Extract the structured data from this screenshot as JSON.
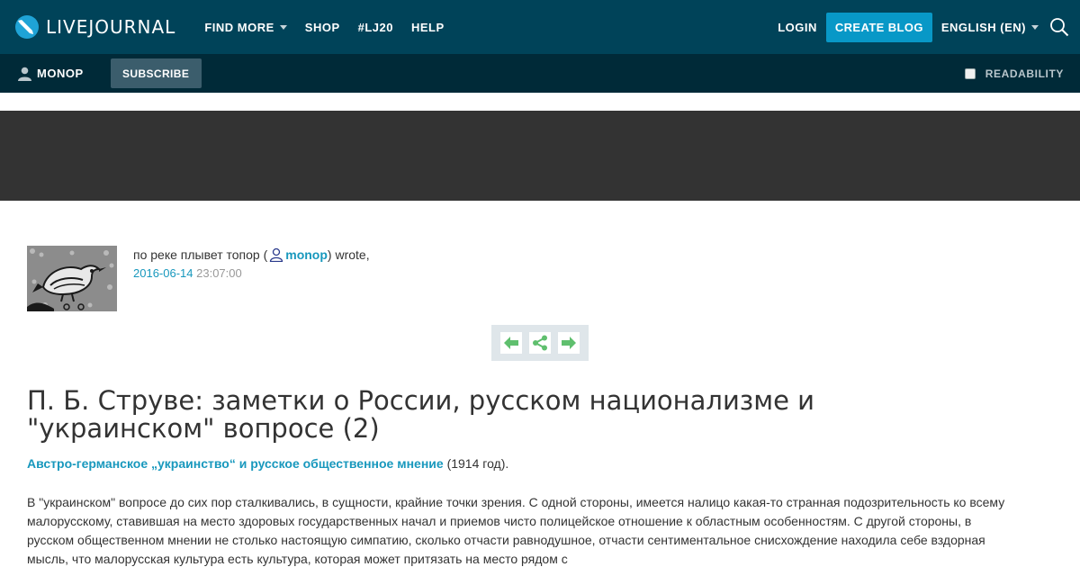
{
  "header": {
    "logo_text": "LIVEJOURNAL",
    "nav": [
      {
        "label": "FIND MORE",
        "dropdown": true
      },
      {
        "label": "SHOP",
        "dropdown": false
      },
      {
        "label": "#LJ20",
        "dropdown": false
      },
      {
        "label": "HELP",
        "dropdown": false
      }
    ],
    "login_label": "LOGIN",
    "create_blog_label": "CREATE BLOG",
    "language_label": "ENGLISH (EN)",
    "search_icon": "search-icon"
  },
  "subbar": {
    "username": "MONOP",
    "subscribe_label": "SUBSCRIBE",
    "readability_label": "READABILITY"
  },
  "post": {
    "journal_name": "по реке плывет топор (",
    "author": "monop",
    "wrote_suffix": ") wrote,",
    "date": "2016-06-14",
    "time": "23:07:00",
    "title": "П. Б. Струве: заметки о России, русском национализме и \"украинском\" вопросе (2)",
    "source_link": "Австро-германское „украинство“ и русское общественное мнение",
    "source_year": " (1914 год).",
    "body": "В \"украинском\" вопросе до сих пор сталкивались, в сущности, крайние точки зрения. С одной стороны, имеется налицо какая-то странная подозрительность ко всему малорусскому, ставившая на место здоровых государственных начал и приемов чисто полицейское отношение к областным особенностям. С другой стороны, в русском общественном мнении не столько настоящую симпатию, сколько отчасти равнодушное, отчасти сентиментальное снисхождение находила себе вздорная мысль, что малорусская культура есть культура, которая может притязать на место рядом с"
  },
  "colors": {
    "topbar": "#004359",
    "subbar": "#002a38",
    "accent": "#0898c7",
    "link": "#1898bd",
    "banner": "#333333",
    "control_arrows": "#5fbf6e"
  }
}
